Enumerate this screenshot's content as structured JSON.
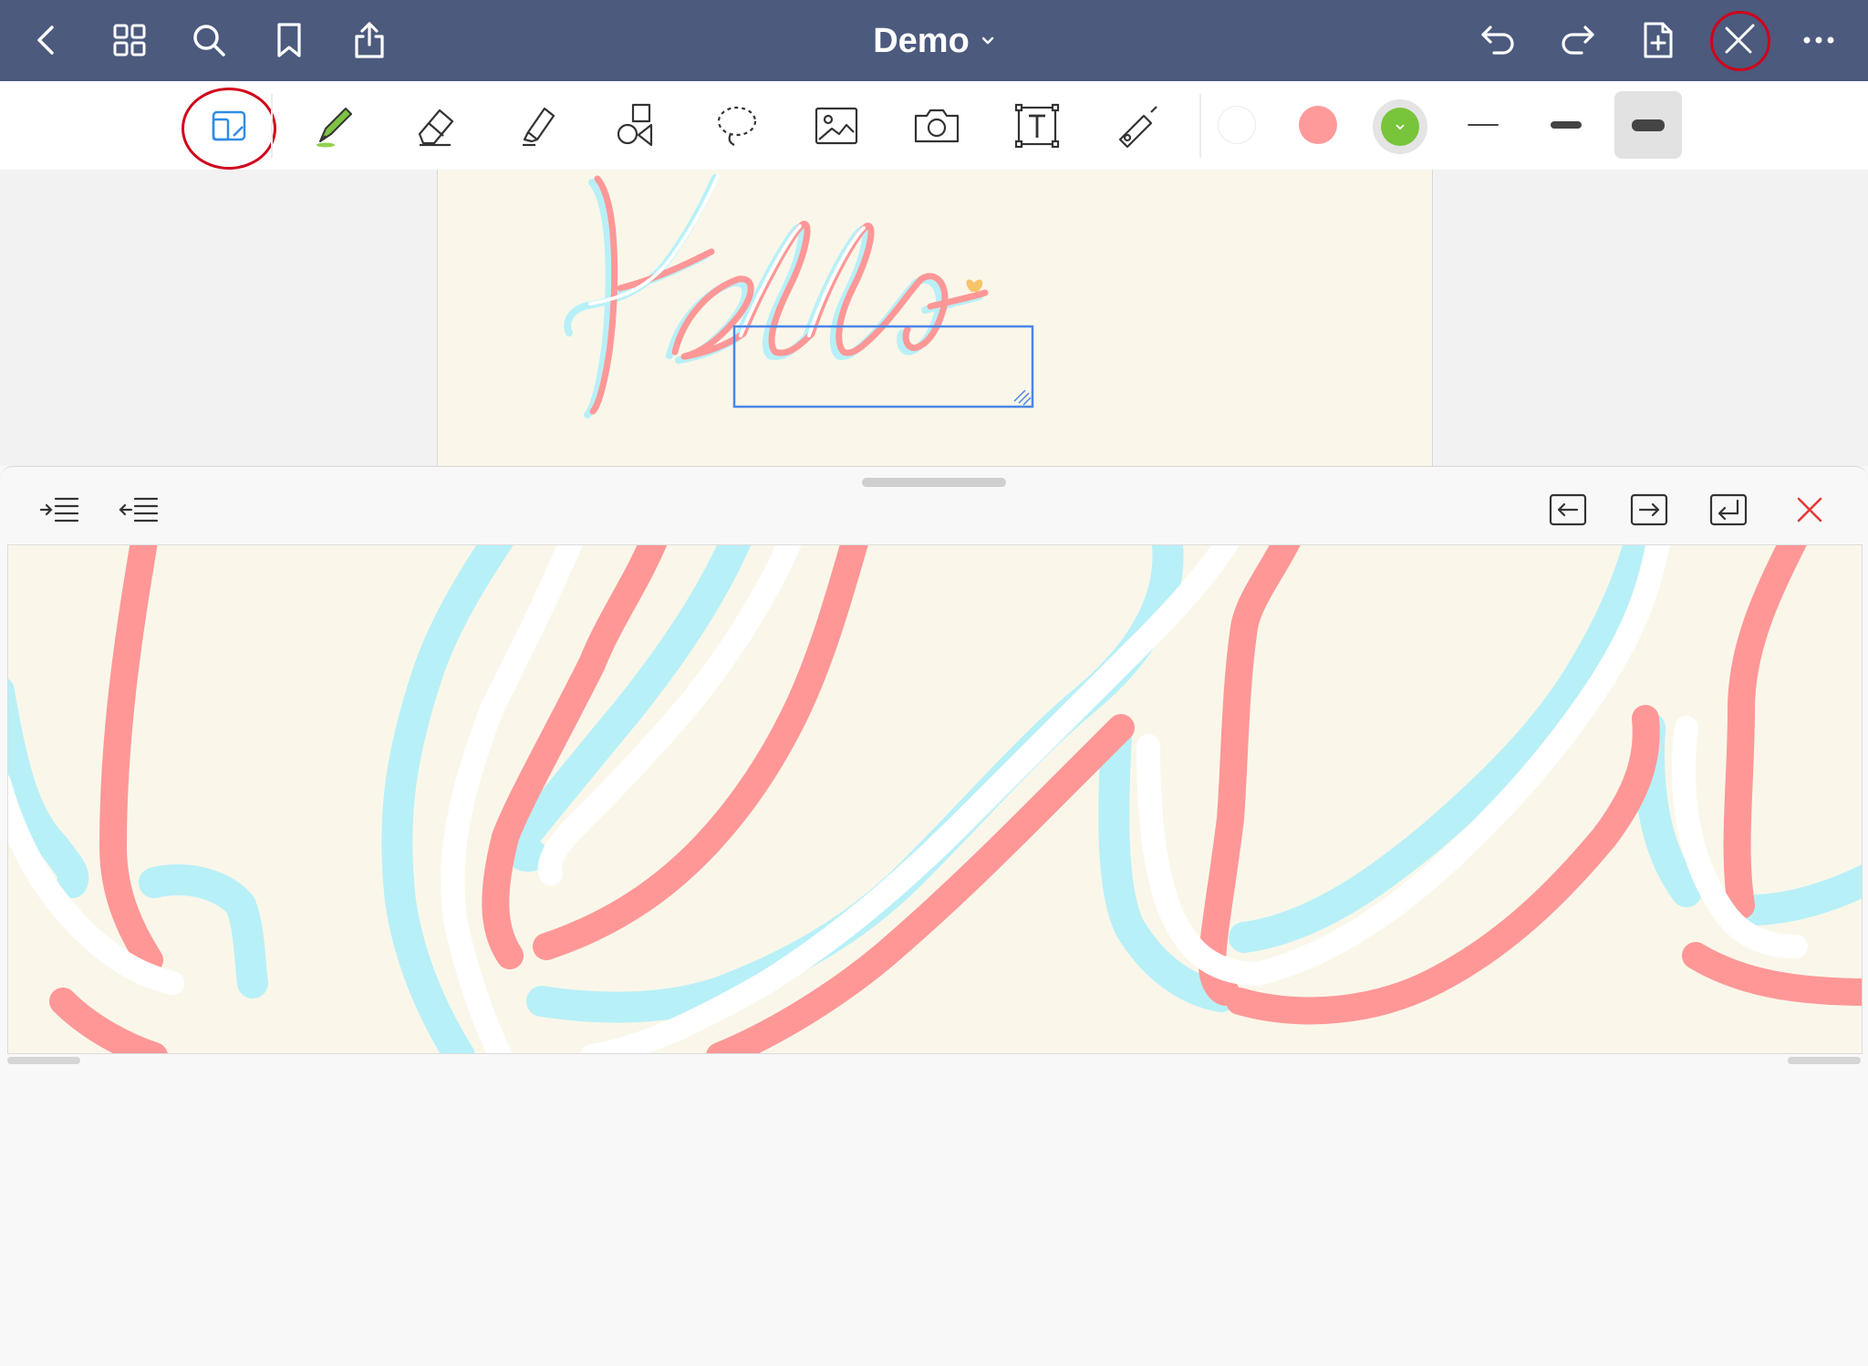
{
  "header": {
    "title": "Demo",
    "left_icons": [
      "back-icon",
      "grid-icon",
      "search-icon",
      "bookmark-icon",
      "share-icon"
    ],
    "right_icons": [
      "undo-icon",
      "redo-icon",
      "add-page-icon",
      "pen-close-icon",
      "more-icon"
    ]
  },
  "toolbar": {
    "tools": [
      "zoom-window-icon",
      "pen-icon",
      "eraser-icon",
      "highlighter-icon",
      "shapes-icon",
      "lasso-icon",
      "image-icon",
      "camera-icon",
      "text-icon",
      "laser-icon"
    ],
    "colors": {
      "white": "#ffffff",
      "pink": "#ff9a9a",
      "green": "#78c43a"
    }
  },
  "zoom_panel": {
    "icons": [
      "indent-icon",
      "outdent-icon",
      "move-left-icon",
      "move-right-icon",
      "new-line-icon",
      "close-icon"
    ]
  },
  "colors": {
    "nav": "#4b5a7d",
    "paper": "#faf7ea",
    "pink_stroke": "#ff9797",
    "blue_stroke": "#b8f0f8",
    "accent_red": "#d0021b",
    "accent_blue": "#4a86e8",
    "heart": "#f7c46a"
  }
}
